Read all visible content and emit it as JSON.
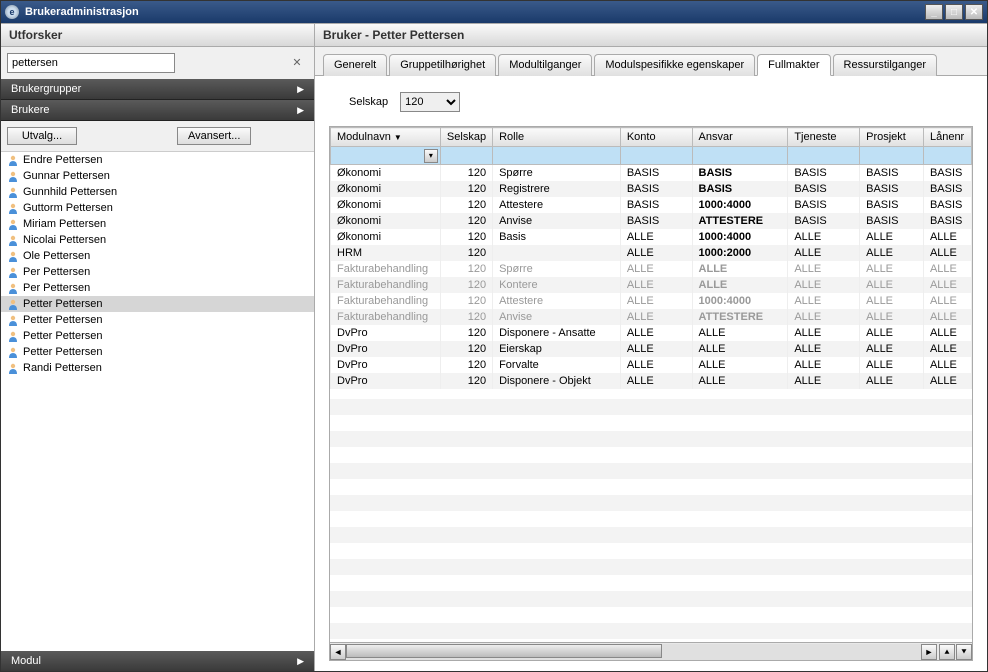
{
  "window": {
    "title": "Brukeradministrasjon"
  },
  "explorer": {
    "title": "Utforsker",
    "search_value": "pettersen",
    "accordion": {
      "brukergrupper": "Brukergrupper",
      "brukere": "Brukere",
      "modul": "Modul"
    },
    "buttons": {
      "utvalg": "Utvalg...",
      "avansert": "Avansert..."
    },
    "users": [
      {
        "name": "Endre Pettersen"
      },
      {
        "name": "Gunnar Pettersen"
      },
      {
        "name": "Gunnhild Pettersen"
      },
      {
        "name": "Guttorm Pettersen"
      },
      {
        "name": "Miriam Pettersen"
      },
      {
        "name": "Nicolai Pettersen"
      },
      {
        "name": "Ole Pettersen"
      },
      {
        "name": "Per Pettersen"
      },
      {
        "name": "Per Pettersen"
      },
      {
        "name": "Petter Pettersen",
        "selected": true
      },
      {
        "name": "Petter Pettersen"
      },
      {
        "name": "Petter Pettersen"
      },
      {
        "name": "Petter Pettersen"
      },
      {
        "name": "Randi Pettersen"
      }
    ]
  },
  "main": {
    "title": "Bruker - Petter Pettersen",
    "tabs": [
      {
        "label": "Generelt"
      },
      {
        "label": "Gruppetilhørighet"
      },
      {
        "label": "Modultilganger"
      },
      {
        "label": "Modulspesifikke egenskaper"
      },
      {
        "label": "Fullmakter",
        "active": true
      },
      {
        "label": "Ressurstilganger"
      }
    ],
    "selskap_label": "Selskap",
    "selskap_value": "120",
    "columns": [
      "Modulnavn",
      "Selskap",
      "Rolle",
      "Konto",
      "Ansvar",
      "Tjeneste",
      "Prosjekt",
      "Lånenr"
    ],
    "rows": [
      {
        "modul": "Økonomi",
        "selskap": "120",
        "rolle": "Spørre",
        "konto": "BASIS",
        "ansvar": "BASIS",
        "ansvar_bold": true,
        "tjeneste": "BASIS",
        "prosjekt": "BASIS",
        "lanenr": "BASIS"
      },
      {
        "modul": "Økonomi",
        "selskap": "120",
        "rolle": "Registrere",
        "konto": "BASIS",
        "ansvar": "BASIS",
        "ansvar_bold": true,
        "tjeneste": "BASIS",
        "prosjekt": "BASIS",
        "lanenr": "BASIS"
      },
      {
        "modul": "Økonomi",
        "selskap": "120",
        "rolle": "Attestere",
        "konto": "BASIS",
        "ansvar": "1000:4000",
        "ansvar_bold": true,
        "tjeneste": "BASIS",
        "prosjekt": "BASIS",
        "lanenr": "BASIS"
      },
      {
        "modul": "Økonomi",
        "selskap": "120",
        "rolle": "Anvise",
        "konto": "BASIS",
        "ansvar": "ATTESTERE",
        "ansvar_bold": true,
        "tjeneste": "BASIS",
        "prosjekt": "BASIS",
        "lanenr": "BASIS"
      },
      {
        "modul": "Økonomi",
        "selskap": "120",
        "rolle": "Basis",
        "konto": "ALLE",
        "ansvar": "1000:4000",
        "ansvar_bold": true,
        "tjeneste": "ALLE",
        "prosjekt": "ALLE",
        "lanenr": "ALLE"
      },
      {
        "modul": "HRM",
        "selskap": "120",
        "rolle": "",
        "konto": "ALLE",
        "ansvar": "1000:2000",
        "ansvar_bold": true,
        "tjeneste": "ALLE",
        "prosjekt": "ALLE",
        "lanenr": "ALLE"
      },
      {
        "modul": "Fakturabehandling",
        "selskap": "120",
        "rolle": "Spørre",
        "konto": "ALLE",
        "ansvar": "ALLE",
        "ansvar_bold": true,
        "tjeneste": "ALLE",
        "prosjekt": "ALLE",
        "lanenr": "ALLE",
        "gray": true
      },
      {
        "modul": "Fakturabehandling",
        "selskap": "120",
        "rolle": "Kontere",
        "konto": "ALLE",
        "ansvar": "ALLE",
        "ansvar_bold": true,
        "tjeneste": "ALLE",
        "prosjekt": "ALLE",
        "lanenr": "ALLE",
        "gray": true
      },
      {
        "modul": "Fakturabehandling",
        "selskap": "120",
        "rolle": "Attestere",
        "konto": "ALLE",
        "ansvar": "1000:4000",
        "ansvar_bold": true,
        "tjeneste": "ALLE",
        "prosjekt": "ALLE",
        "lanenr": "ALLE",
        "gray": true
      },
      {
        "modul": "Fakturabehandling",
        "selskap": "120",
        "rolle": "Anvise",
        "konto": "ALLE",
        "ansvar": "ATTESTERE",
        "ansvar_bold": true,
        "tjeneste": "ALLE",
        "prosjekt": "ALLE",
        "lanenr": "ALLE",
        "gray": true
      },
      {
        "modul": "DvPro",
        "selskap": "120",
        "rolle": "Disponere - Ansatte",
        "konto": "ALLE",
        "ansvar": "ALLE",
        "tjeneste": "ALLE",
        "prosjekt": "ALLE",
        "lanenr": "ALLE"
      },
      {
        "modul": "DvPro",
        "selskap": "120",
        "rolle": "Eierskap",
        "konto": "ALLE",
        "ansvar": "ALLE",
        "tjeneste": "ALLE",
        "prosjekt": "ALLE",
        "lanenr": "ALLE"
      },
      {
        "modul": "DvPro",
        "selskap": "120",
        "rolle": "Forvalte",
        "konto": "ALLE",
        "ansvar": "ALLE",
        "tjeneste": "ALLE",
        "prosjekt": "ALLE",
        "lanenr": "ALLE"
      },
      {
        "modul": "DvPro",
        "selskap": "120",
        "rolle": "Disponere - Objekt",
        "konto": "ALLE",
        "ansvar": "ALLE",
        "tjeneste": "ALLE",
        "prosjekt": "ALLE",
        "lanenr": "ALLE"
      }
    ]
  }
}
